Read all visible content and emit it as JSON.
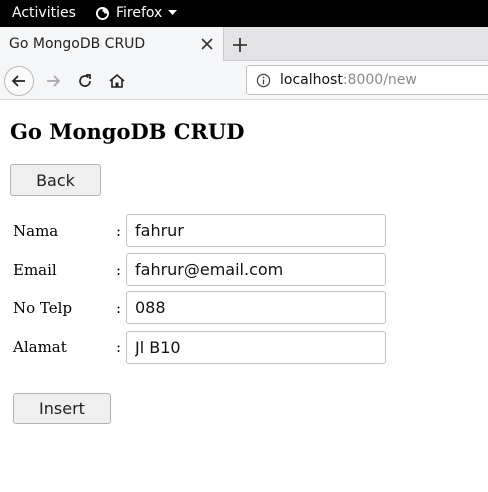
{
  "system_bar": {
    "activities": "Activities",
    "app_name": "Firefox"
  },
  "browser": {
    "tab_title": "Go MongoDB CRUD",
    "url_host": "localhost",
    "url_rest": ":8000/new"
  },
  "page": {
    "title": "Go MongoDB CRUD",
    "back_button": "Back",
    "separator": ":",
    "fields": [
      {
        "label": "Nama",
        "value": "fahrur"
      },
      {
        "label": "Email",
        "value": "fahrur@email.com"
      },
      {
        "label": "No Telp",
        "value": "088"
      },
      {
        "label": "Alamat",
        "value": "Jl B10"
      }
    ],
    "insert_button": "Insert"
  }
}
